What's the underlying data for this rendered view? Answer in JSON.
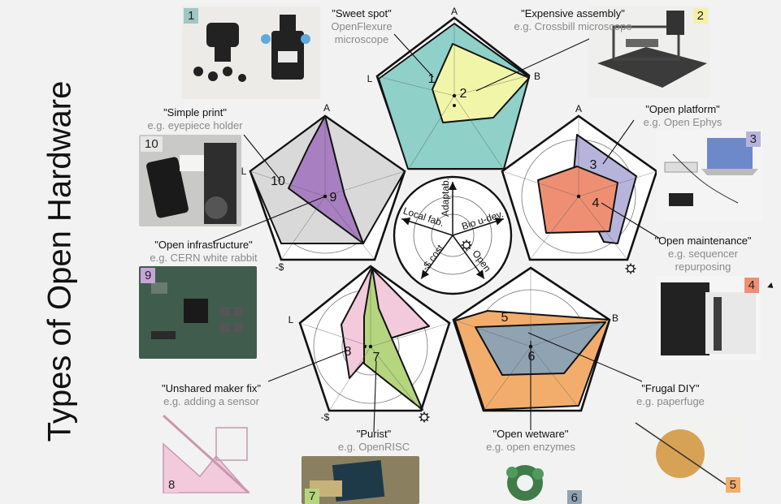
{
  "title": "Types of Open Hardware",
  "axis_letters": {
    "a": "A",
    "b": "B",
    "l": "L",
    "neg": "-$"
  },
  "center_axes": {
    "adaptab": "Adaptab.",
    "bio": "Bio u-dev.",
    "local": "Local fab.",
    "cost": "-$ cost",
    "open": "Open"
  },
  "types": [
    {
      "num": "1",
      "name": "\"Sweet spot\"",
      "example": "OpenFlexure microscope"
    },
    {
      "num": "2",
      "name": "\"Expensive assembly\"",
      "example": "e.g. Crossbill microscope"
    },
    {
      "num": "3",
      "name": "\"Open platform\"",
      "example": "e.g. Open Ephys"
    },
    {
      "num": "4",
      "name": "\"Open maintenance\"",
      "example_line1": "e.g. sequencer",
      "example_line2": "repurposing"
    },
    {
      "num": "5",
      "name": "\"Frugal DIY\"",
      "example": "e.g. paperfuge"
    },
    {
      "num": "6",
      "name": "\"Open wetware\"",
      "example": "e.g. open enzymes"
    },
    {
      "num": "7",
      "name": "\"Purist\"",
      "example": "e.g. OpenRISC"
    },
    {
      "num": "8",
      "name": "\"Unshared maker fix\"",
      "example": "e.g. adding a sensor"
    },
    {
      "num": "9",
      "name": "\"Open infrastructure\"",
      "example": "e.g. CERN white rabbit"
    },
    {
      "num": "10",
      "name": "\"Simple print\"",
      "example": "e.g. eyepiece holder"
    }
  ],
  "colors": {
    "teal": "#8fd0c9",
    "yellow": "#f1f5a8",
    "lavender": "#b7b4dc",
    "salmon": "#ee8f73",
    "orange": "#f2ad6c",
    "slate": "#8fa3b3",
    "pink": "#f3c9dc",
    "green": "#b5d57e",
    "purple": "#a87fc0",
    "grey": "#d9d9d9"
  }
}
